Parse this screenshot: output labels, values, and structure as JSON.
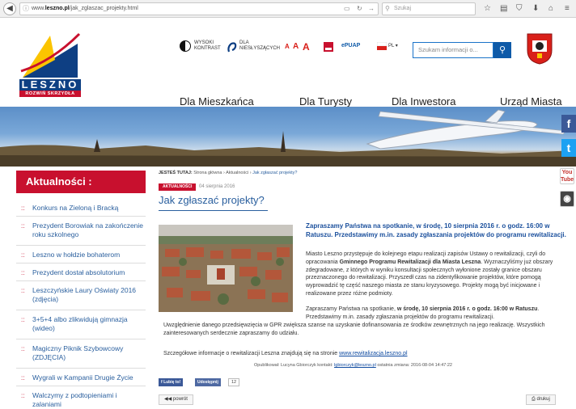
{
  "browser": {
    "url_prefix": "www.",
    "url_domain": "leszno.pl",
    "url_path": "/jak_zglaszac_projekty.html",
    "search_placeholder": "Szukaj"
  },
  "header": {
    "logo_word": "LESZNO",
    "logo_sub": "ROZWIŃ SKRZYDŁA",
    "tools": {
      "contrast_label": "WYSOKI KONTRAST",
      "disabled_label": "DLA NIESŁYSZĄCYCH",
      "font_a1": "A",
      "font_a2": "A",
      "font_a3": "A",
      "bip_label": "ePUAP",
      "lang_label": "PL"
    },
    "search_placeholder": "Szukam informacji o...",
    "nav": [
      "Dla Mieszkańca",
      "Dla Turysty",
      "Dla Inwestora",
      "Urząd Miasta"
    ]
  },
  "social": {
    "facebook": "f",
    "twitter": "t",
    "youtube_top": "You",
    "youtube_bottom": "Tube"
  },
  "sidebar": {
    "title": "Aktualności :",
    "items": [
      "Konkurs na Zieloną i Bracką",
      "Prezydent Borowiak na zakończenie roku szkolnego",
      "Leszno w hołdzie bohaterom",
      "Prezydent dostał absolutorium",
      "Leszczyńskie Laury Oświaty 2016 (zdjęcia)",
      "3+5+4 albo zlikwidują gimnazja (wideo)",
      "Magiczny Piknik Szybowcowy (ZDJĘCIA)",
      "Wygrali w Kampanii Drugie Życie",
      "Walczymy z podtopieniami i zalaniami"
    ]
  },
  "content": {
    "breadcrumb_label": "JESTEŚ TUTAJ:",
    "breadcrumb": [
      "Strona główna",
      "Aktualności",
      "Jak zgłaszać projekty?"
    ],
    "tag": "AKTUALNOŚCI",
    "date": "04 sierpnia 2016",
    "title": "Jak zgłaszać projekty?",
    "lead": "Zapraszamy Państwa na spotkanie, w środę, 10 sierpnia 2016 r. o godz. 16:00 w Ratuszu. Przedstawimy m.in. zasady zgłaszania projektów do programu rewitalizacji.",
    "p1_a": "Miasto Leszno przystępuje do kolejnego etapu realizacji zapisów Ustawy o rewitalizacji, czyli do opracowania ",
    "p1_bold": "Gminnego Programu Rewitalizacji dla Miasta Leszna",
    "p1_b": ". Wyznaczyliśmy już obszary zdegradowane, z których w wyniku konsultacji społecznych wyłonione zostały granice obszaru przeznaczonego do rewitalizacji. Przyszedł czas na zidentyfikowanie projektów, które pomogą wyprowadzić tę część naszego miasta ze stanu kryzysowego. Projekty mogą być inicjowane i realizowane przez różne podmioty.",
    "p2_a": "Zapraszamy Państwa na spotkanie, ",
    "p2_bold1": "w środę, 10 sierpnia 2016 r. o godz. 16:00 w Ratuszu",
    "p2_b": ". Przedstawimy m.in. zasady zgłaszania projektów do programu rewitalizacji.",
    "p3": "Uwzględnienie danego przedsięwzięcia w GPR zwiększa szanse na uzyskanie dofinansowania ze środków zewnętrznych na jego realizację. Wszystkich zainteresowanych serdecznie zapraszamy do udziału.",
    "p4_a": "Szczegółowe informacje o rewitalizacji Leszna znajdują się na stronie ",
    "p4_link": "www.rewitalizacja.leszno.pl",
    "author_prefix": "Opublikował: Lucyna Gbiorczyk kontakt: ",
    "author_email": "lgbiorczyk@leszno.pl",
    "author_suffix": " ostatnia zmiana: 2016-08-04 14:47:22",
    "fb_like": "Lubię to!",
    "fb_share": "Udostępnij",
    "fb_count": "12",
    "back": "powrót",
    "print": "drukuj"
  }
}
